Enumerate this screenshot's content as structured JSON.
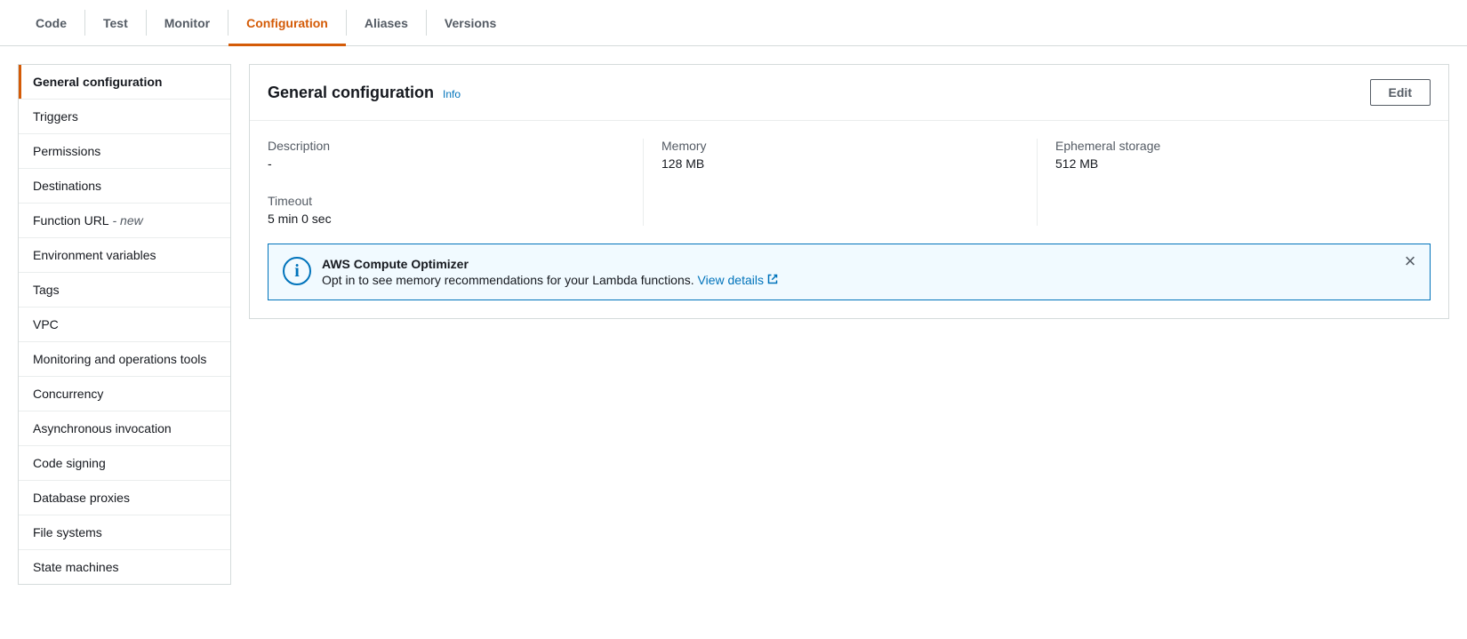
{
  "tabs": [
    {
      "id": "code",
      "label": "Code"
    },
    {
      "id": "test",
      "label": "Test"
    },
    {
      "id": "monitor",
      "label": "Monitor"
    },
    {
      "id": "configuration",
      "label": "Configuration"
    },
    {
      "id": "aliases",
      "label": "Aliases"
    },
    {
      "id": "versions",
      "label": "Versions"
    }
  ],
  "active_tab": "configuration",
  "sidebar": {
    "items": [
      {
        "id": "general",
        "label": "General configuration",
        "active": true
      },
      {
        "id": "triggers",
        "label": "Triggers"
      },
      {
        "id": "permissions",
        "label": "Permissions"
      },
      {
        "id": "destinations",
        "label": "Destinations"
      },
      {
        "id": "function-url",
        "label": "Function URL",
        "badge": " - new"
      },
      {
        "id": "env-vars",
        "label": "Environment variables"
      },
      {
        "id": "tags",
        "label": "Tags"
      },
      {
        "id": "vpc",
        "label": "VPC"
      },
      {
        "id": "monitoring-tools",
        "label": "Monitoring and operations tools"
      },
      {
        "id": "concurrency",
        "label": "Concurrency"
      },
      {
        "id": "async",
        "label": "Asynchronous invocation"
      },
      {
        "id": "code-signing",
        "label": "Code signing"
      },
      {
        "id": "db-proxies",
        "label": "Database proxies"
      },
      {
        "id": "file-systems",
        "label": "File systems"
      },
      {
        "id": "state-machines",
        "label": "State machines"
      }
    ]
  },
  "panel": {
    "title": "General configuration",
    "info_label": "Info",
    "edit_label": "Edit",
    "props": {
      "description": {
        "label": "Description",
        "value": "-"
      },
      "timeout": {
        "label": "Timeout",
        "value": "5 min 0 sec"
      },
      "memory": {
        "label": "Memory",
        "value": "128 MB"
      },
      "ephemeral": {
        "label": "Ephemeral storage",
        "value": "512 MB"
      }
    },
    "notice": {
      "title": "AWS Compute Optimizer",
      "text": "Opt in to see memory recommendations for your Lambda functions. ",
      "link_label": "View details"
    }
  }
}
